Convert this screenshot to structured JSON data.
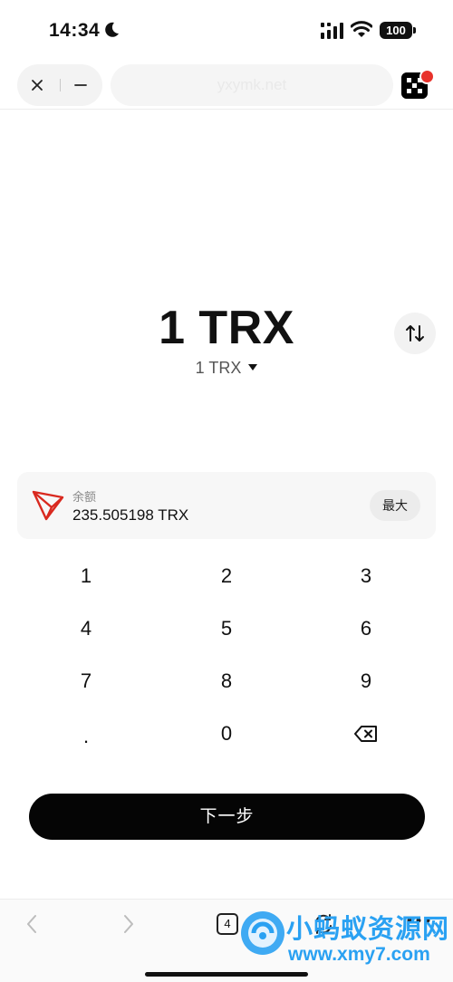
{
  "status_bar": {
    "time": "14:34",
    "battery": "100"
  },
  "browser": {
    "url": "yxymk.net"
  },
  "amount": {
    "main": "1 TRX",
    "secondary": "1  TRX"
  },
  "balance": {
    "label": "余额",
    "value": "235.505198  TRX",
    "max_label": "最大"
  },
  "keypad": {
    "keys": [
      "1",
      "2",
      "3",
      "4",
      "5",
      "6",
      "7",
      "8",
      "9",
      ".",
      "0"
    ]
  },
  "next_button": {
    "label": "下一步"
  },
  "bottom_bar": {
    "tabs_count": "4"
  },
  "watermark": {
    "name": "小蚂蚁资源网",
    "url": "www.xmy7.com"
  },
  "colors": {
    "accent": "#000000",
    "tron_red": "#d9291f",
    "watermark_blue": "#2aa1f2"
  },
  "icons": [
    "moon-icon",
    "signal-icon",
    "wifi-icon",
    "close-icon",
    "minus-icon",
    "okx-logo",
    "swap-icon",
    "tron-icon",
    "backspace-icon",
    "chevron-left-icon",
    "chevron-right-icon",
    "refresh-icon",
    "more-icon"
  ]
}
